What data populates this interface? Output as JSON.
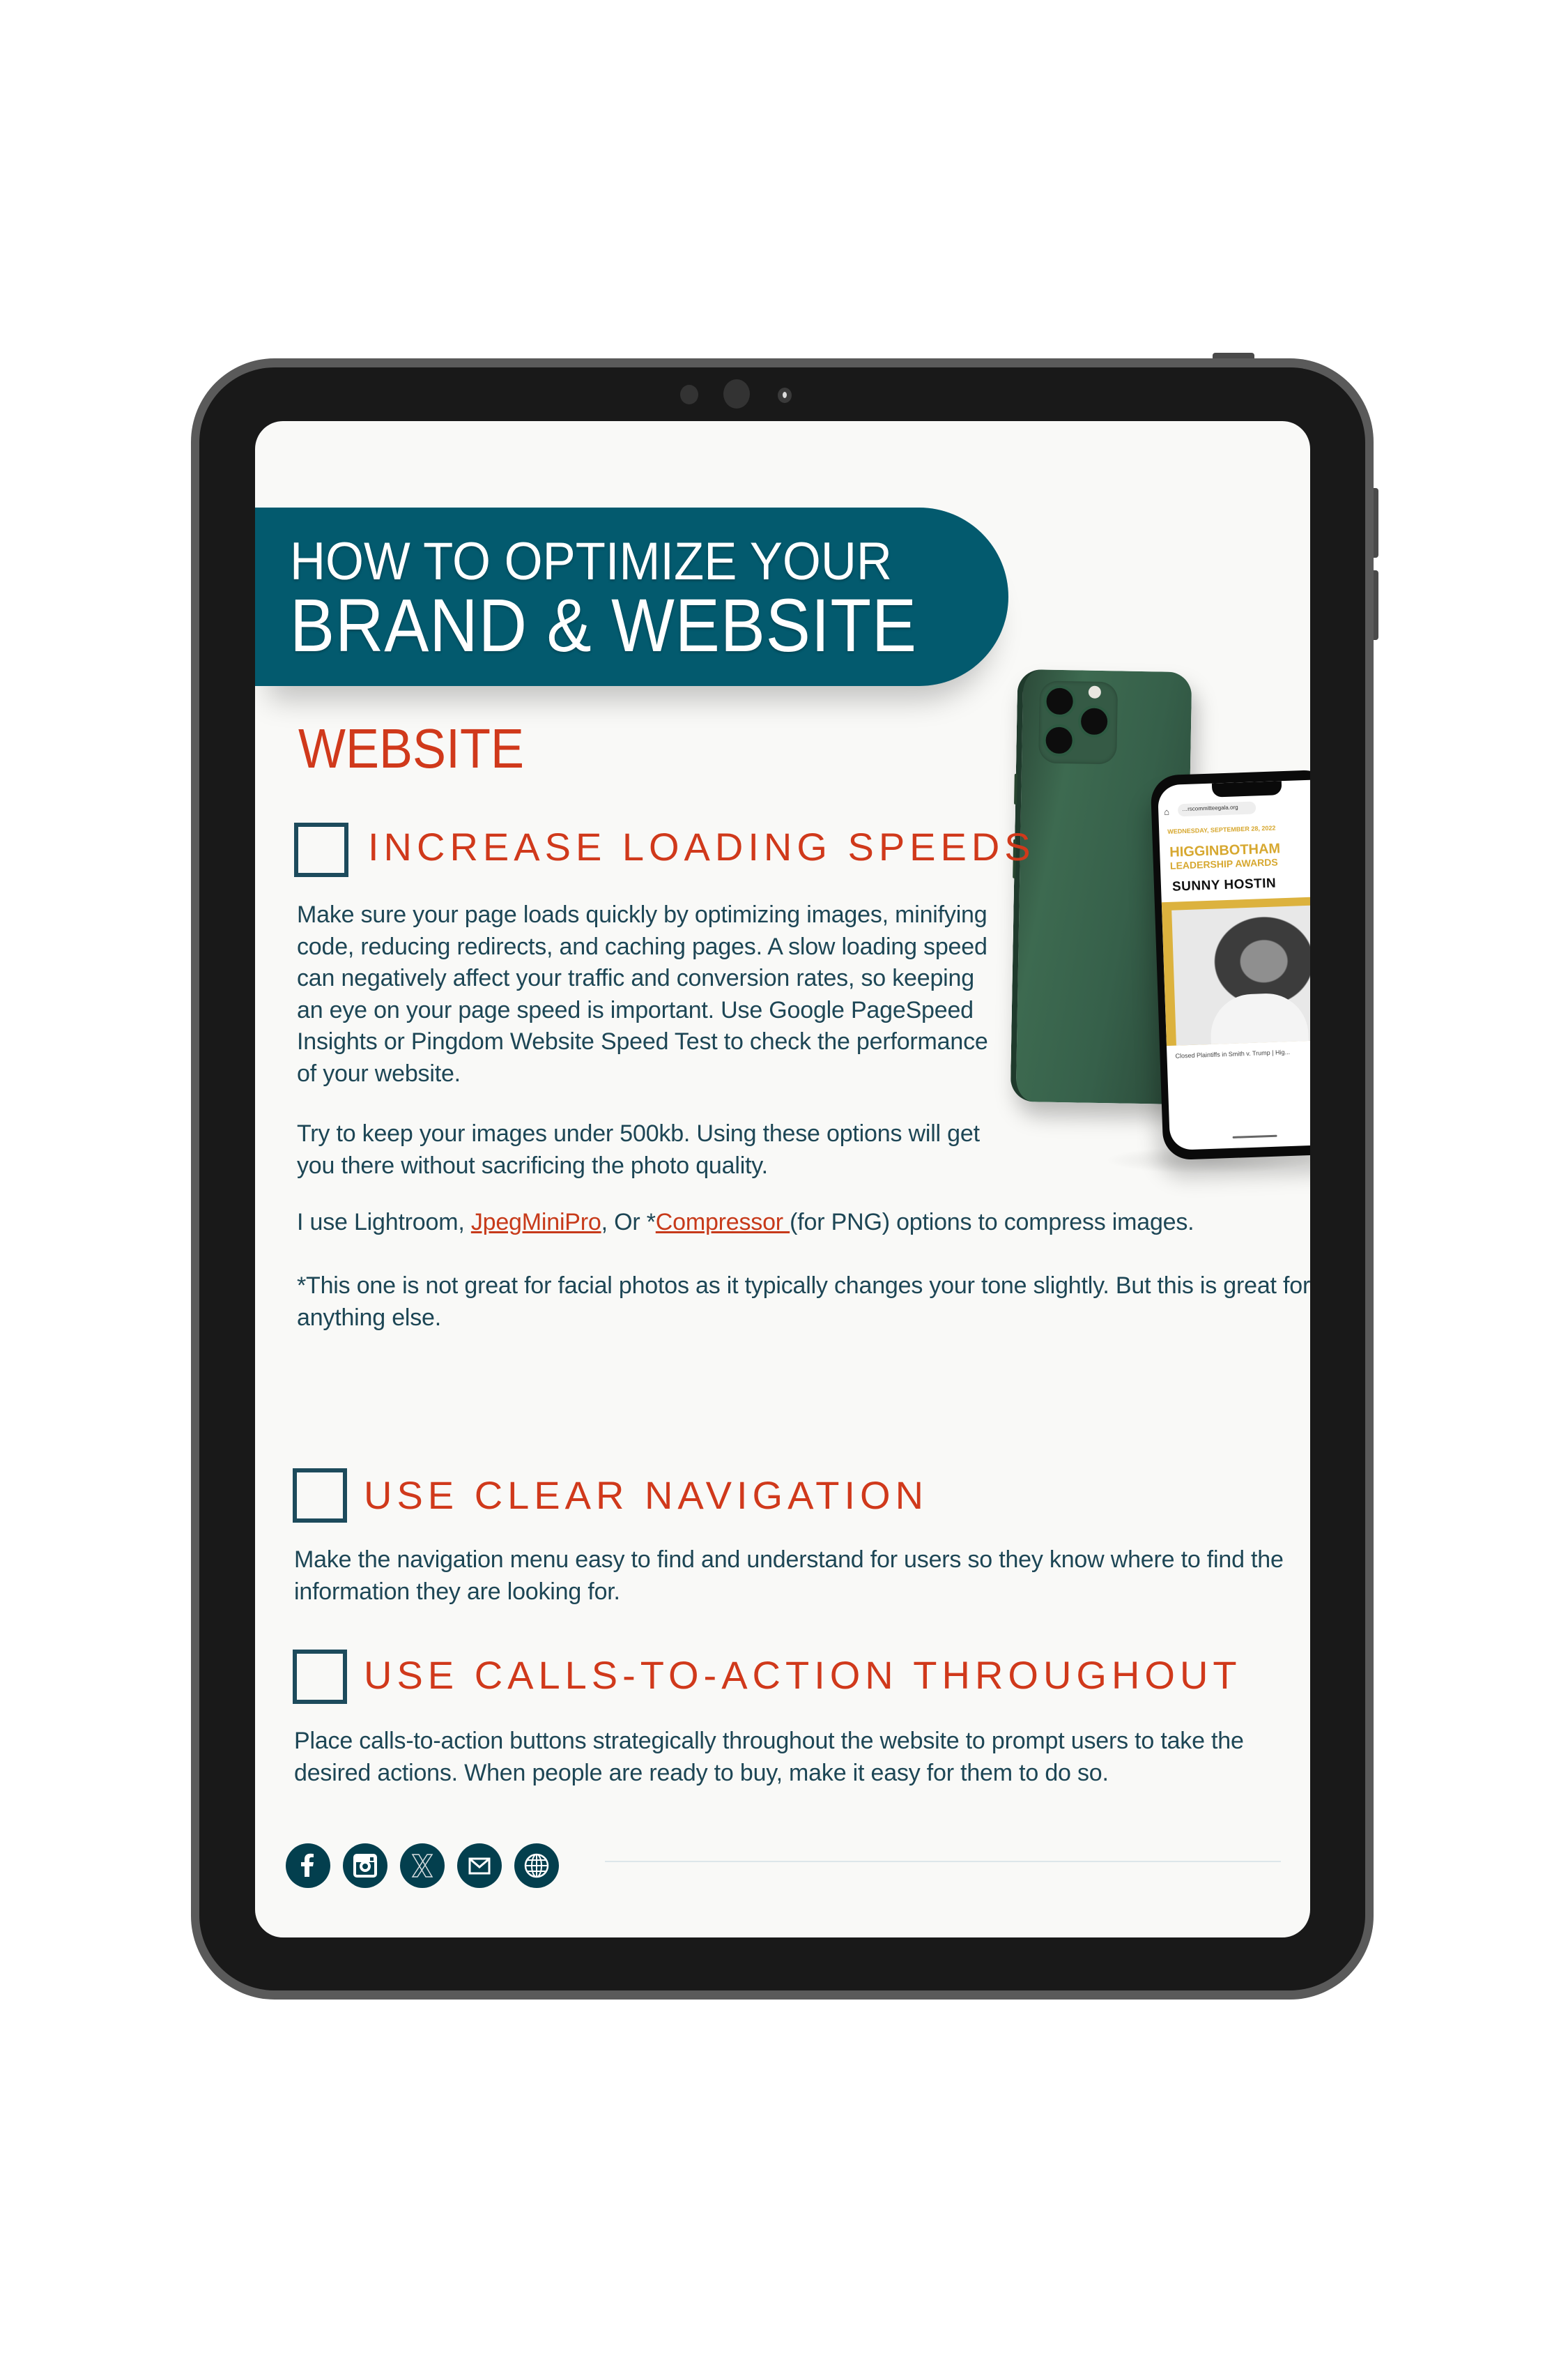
{
  "banner": {
    "line1": "HOW TO OPTIMIZE YOUR",
    "line2": "BRAND & WEBSITE"
  },
  "section_title": "WEBSITE",
  "tasks": [
    {
      "title": "INCREASE LOADING SPEEDS",
      "checked": false,
      "paragraphs": [
        "Make sure your page loads quickly by optimizing images, minifying code, reducing redirects, and caching pages. A slow loading speed can negatively affect your traffic and conversion rates, so keeping an eye on your page speed is important. Use Google PageSpeed Insights or Pingdom Website Speed Test to check the performance of your website.",
        "Try to keep your images under 500kb. Using these options will get you there without sacrificing the photo quality."
      ],
      "tools_line": {
        "prefix": "I use Lightroom, ",
        "link1": "JpegMiniPro",
        "middle": ", Or *",
        "link2": "Compressor ",
        "suffix": "(for PNG) options to compress images."
      },
      "footnote": "*This one is not great for facial photos as it typically changes your tone slightly. But this is great for anything else."
    },
    {
      "title": "USE CLEAR NAVIGATION",
      "checked": false,
      "paragraphs": [
        "Make the navigation menu easy to find and understand for users so they know where to find the information they are looking for."
      ]
    },
    {
      "title": "USE CALLS-TO-ACTION THROUGHOUT",
      "checked": false,
      "paragraphs": [
        "Place calls-to-action buttons strategically throughout the website to prompt users to take the desired actions. When people are ready to buy, make it easy for them to do so."
      ]
    }
  ],
  "social_links": [
    {
      "icon": "facebook-icon",
      "label": "Facebook"
    },
    {
      "icon": "instagram-icon",
      "label": "Instagram"
    },
    {
      "icon": "x-icon",
      "label": "X"
    },
    {
      "icon": "mail-icon",
      "label": "Email"
    },
    {
      "icon": "globe-icon",
      "label": "Website"
    }
  ],
  "phone_mockup": {
    "url": "…rscommitteegala.org",
    "date": "WEDNESDAY, SEPTEMBER 28, 2022",
    "event_title": "HIGGINBOTHAM",
    "event_subtitle": "LEADERSHIP AWARDS",
    "honoree": "SUNNY HOSTIN",
    "caption": "Closed Plaintiffs in Smith v. Trump | Hig..."
  },
  "colors": {
    "banner": "#035a6e",
    "accent_red": "#d0391b",
    "body_text": "#1d4655",
    "checkbox_border": "#1d4b5c",
    "social_bg": "#033f4e",
    "screen_bg": "#f9f9f7",
    "tablet_bezel": "#191919",
    "tablet_rim": "#5a5a5a",
    "gold": "#d7a830"
  }
}
